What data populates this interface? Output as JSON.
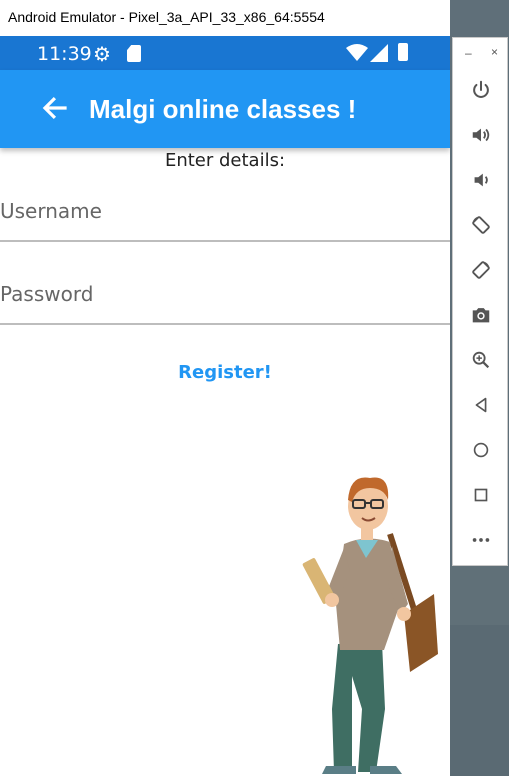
{
  "window": {
    "title": "Android Emulator - Pixel_3a_API_33_x86_64:5554"
  },
  "status_bar": {
    "time": "11:39"
  },
  "app_bar": {
    "title": "Malgi online classes !"
  },
  "form": {
    "heading": "Enter details:",
    "username_placeholder": "Username",
    "password_placeholder": "Password",
    "register_label": "Register!"
  },
  "emulator_toolbar": {
    "minimize": "–",
    "close": "×",
    "buttons": [
      "power-icon",
      "volume-up-icon",
      "volume-down-icon",
      "rotate-left-icon",
      "rotate-right-icon",
      "camera-icon",
      "zoom-icon",
      "back-icon",
      "home-icon",
      "overview-icon",
      "more-icon"
    ]
  },
  "colors": {
    "app_bar": "#2196f3",
    "status_bar": "#1976d2",
    "link": "#2196f3"
  }
}
